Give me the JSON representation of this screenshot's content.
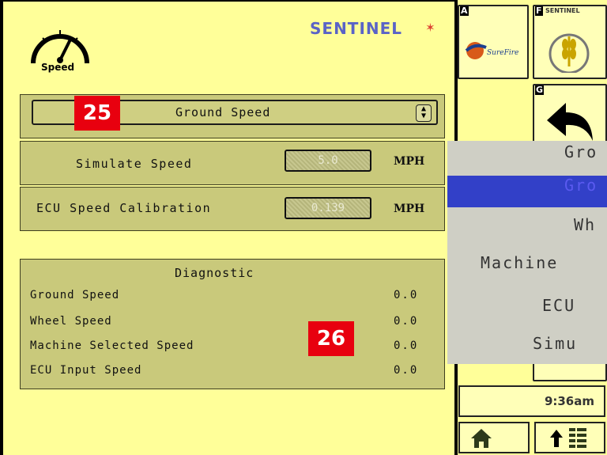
{
  "header": {
    "speed_icon_label": "Speed",
    "brand": "SENTINEL"
  },
  "speed_source_dropdown": {
    "value": "Ground Speed",
    "badge": "25"
  },
  "simulate_speed": {
    "label": "Simulate Speed",
    "value": "5.0",
    "unit": "MPH"
  },
  "ecu_calibration": {
    "label": "ECU Speed Calibration",
    "value": "0.139",
    "unit": "MPH"
  },
  "diagnostic": {
    "title": "Diagnostic",
    "badge": "26",
    "rows": [
      {
        "label": "Ground Speed",
        "value": "0.0"
      },
      {
        "label": "Wheel Speed",
        "value": "0.0"
      },
      {
        "label": "Machine Selected Speed",
        "value": "0.0"
      },
      {
        "label": "ECU Input Speed",
        "value": "0.0"
      }
    ]
  },
  "softkeys": {
    "A": {
      "letter": "A",
      "text": "SureFire"
    },
    "F": {
      "letter": "F",
      "text": "SENTINEL"
    },
    "G": {
      "letter": "G"
    }
  },
  "dropdown_popup": {
    "items": [
      "Gro",
      "Gro",
      "Wh",
      "Machine",
      "ECU",
      "Simu"
    ],
    "selected_index": 1
  },
  "status": {
    "time": "9:36am"
  },
  "colors": {
    "background": "#ffff99",
    "panel": "#c9c97b",
    "badge": "#e8000f",
    "selection": "#3240c8"
  }
}
